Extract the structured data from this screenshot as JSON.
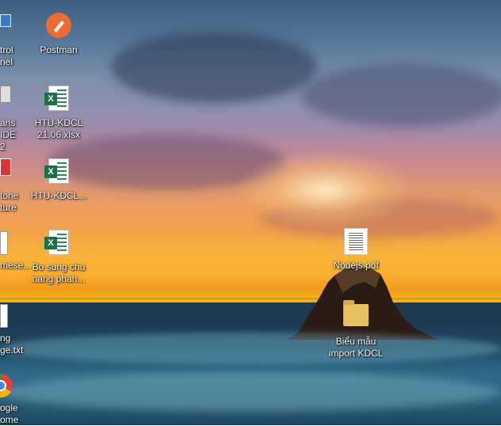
{
  "desktop": {
    "wallpaper": "sunset-over-ocean-rock",
    "icons": [
      {
        "id": "control-panel",
        "label": "trol\nnel"
      },
      {
        "id": "postman",
        "label": "Postman",
        "icon": "postman-icon",
        "color": "#ef6c32"
      },
      {
        "id": "netbeans",
        "label": "ans IDE\n2"
      },
      {
        "id": "htu-kdcl-21",
        "label": "HTU-KDCL\n21.06.xlsx",
        "icon": "excel-icon"
      },
      {
        "id": "stone",
        "label": "tone\nture"
      },
      {
        "id": "htu-kdcl",
        "label": "HTU-KDCL...",
        "icon": "excel-icon"
      },
      {
        "id": "mese",
        "label": "mese..."
      },
      {
        "id": "bo-sung",
        "label": "Bo sung chu\nnang phan...",
        "icon": "excel-icon"
      },
      {
        "id": "nodejs-pdf",
        "label": "Nodejs.pdf",
        "icon": "pdf-icon"
      },
      {
        "id": "ge-txt",
        "label": "ng\nge.txt"
      },
      {
        "id": "bieu-mau",
        "label": "Biểu mẫu\nimport KDCL",
        "icon": "folder-icon"
      },
      {
        "id": "chrome",
        "label": "ogle\nome",
        "icon": "chrome-icon"
      }
    ]
  }
}
